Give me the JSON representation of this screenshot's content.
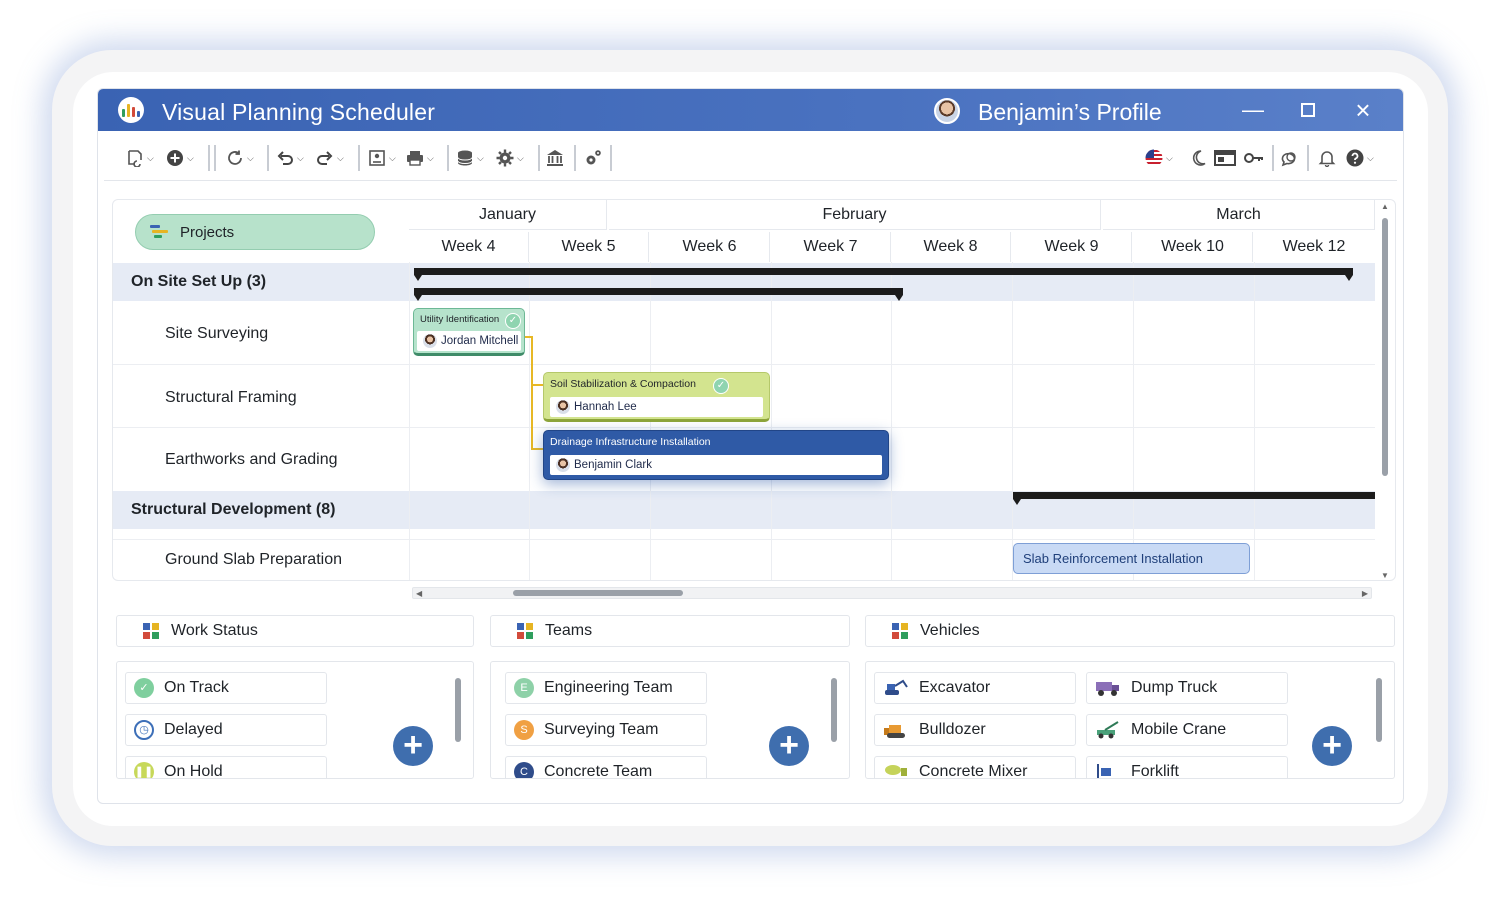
{
  "window": {
    "title": "Visual Planning Scheduler",
    "profile_name": "Benjamin’s Profile",
    "controls": [
      "minimize",
      "maximize",
      "close"
    ]
  },
  "toolbar": {
    "left_icons": [
      "sync-file-icon",
      "add-circle-icon",
      "refresh-icon",
      "undo-icon",
      "redo-icon",
      "contact-card-icon",
      "print-icon",
      "database-icon",
      "settings-gear-icon",
      "institution-icon",
      "advanced-settings-icon"
    ],
    "right_icons": [
      "us-flag-icon",
      "moon-icon",
      "window-icon",
      "key-icon",
      "chat-icon",
      "bell-icon",
      "help-icon"
    ]
  },
  "gantt": {
    "projects_label": "Projects",
    "months": [
      "January",
      "February",
      "March"
    ],
    "weeks": [
      "Week 4",
      "Week 5",
      "Week 6",
      "Week 7",
      "Week 8",
      "Week 9",
      "Week 10",
      "Week 12"
    ],
    "groups": [
      {
        "label": "On Site Set Up (3)",
        "rows": [
          "Site Surveying",
          "Structural Framing",
          "Earthworks and Grading"
        ]
      },
      {
        "label": "Structural Development (8)",
        "rows": [
          "Ground Slab Preparation"
        ]
      }
    ],
    "tasks": [
      {
        "title": "Utility Identification",
        "person": "Jordan Mitchell",
        "status": "on-track",
        "color": "#b6e3cc"
      },
      {
        "title": "Soil Stabilization & Compaction",
        "person": "Hannah Lee",
        "status": "on-track",
        "color": "#d3e48f"
      },
      {
        "title": "Drainage Infrastructure Installation",
        "person": "Benjamin Clark",
        "color": "#2f5aa6"
      },
      {
        "title": "Slab Reinforcement Installation",
        "color": "#c9daf5"
      }
    ]
  },
  "panels": {
    "work_status": {
      "title": "Work Status",
      "items": [
        {
          "label": "On Track",
          "icon": "check-circle-icon",
          "color": "#7fcf9e"
        },
        {
          "label": "Delayed",
          "icon": "clock-icon",
          "color": "#3d6fb8"
        },
        {
          "label": "On Hold",
          "icon": "pause-icon",
          "color": "#c7d85a"
        }
      ]
    },
    "teams": {
      "title": "Teams",
      "items": [
        {
          "label": "Engineering Team",
          "badge": "E",
          "color": "#8ed1a8"
        },
        {
          "label": "Surveying Team",
          "badge": "S",
          "color": "#f0a043"
        },
        {
          "label": "Concrete Team",
          "badge": "C",
          "color": "#2f4c8a"
        }
      ]
    },
    "vehicles": {
      "title": "Vehicles",
      "items": [
        {
          "label": "Excavator",
          "icon": "excavator-icon"
        },
        {
          "label": "Dump Truck",
          "icon": "dump-truck-icon"
        },
        {
          "label": "Bulldozer",
          "icon": "bulldozer-icon"
        },
        {
          "label": "Mobile Crane",
          "icon": "mobile-crane-icon"
        },
        {
          "label": "Concrete Mixer",
          "icon": "concrete-mixer-icon"
        },
        {
          "label": "Forklift",
          "icon": "forklift-icon"
        }
      ]
    }
  }
}
